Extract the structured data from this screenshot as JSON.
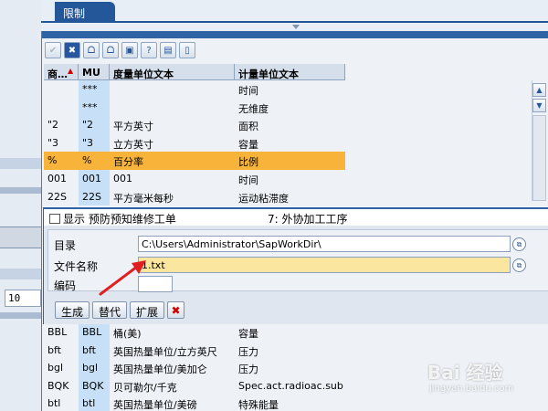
{
  "tab": {
    "label": "限制"
  },
  "table": {
    "headers": [
      "商…",
      "MU",
      "度量单位文本",
      "计量单位文本"
    ],
    "rows": [
      {
        "c1": "",
        "c2": "***",
        "c3": "",
        "c4": "时间"
      },
      {
        "c1": "",
        "c2": "***",
        "c3": "",
        "c4": "无维度"
      },
      {
        "c1": "\"2",
        "c2": "\"2",
        "c3": "平方英寸",
        "c4": "面积"
      },
      {
        "c1": "\"3",
        "c2": "\"3",
        "c3": "立方英寸",
        "c4": "容量"
      },
      {
        "c1": "%",
        "c2": "%",
        "c3": "百分率",
        "c4": "比例"
      },
      {
        "c1": "001",
        "c2": "001",
        "c3": "001",
        "c4": "时间"
      },
      {
        "c1": "22S",
        "c2": "22S",
        "c3": "平方毫米每秒",
        "c4": "运动粘滞度"
      }
    ],
    "lower_rows": [
      {
        "c1": "BBL",
        "c2": "BBL",
        "c3": "桶(美)",
        "c4": "容量"
      },
      {
        "c1": "bft",
        "c2": "bft",
        "c3": "英国热量单位/立方英尺",
        "c4": "压力"
      },
      {
        "c1": "bgl",
        "c2": "bgl",
        "c3": "英国热量单位/美加仑",
        "c4": "压力"
      },
      {
        "c1": "BQK",
        "c2": "BQK",
        "c3": "贝可勒尔/千克",
        "c4": "Spec.act.radioac.sub"
      },
      {
        "c1": "btl",
        "c2": "btl",
        "c3": "英国热量单位/美磅",
        "c4": "特殊能量"
      }
    ]
  },
  "dialog": {
    "title_left": "显示 预防预知维修工单",
    "title_right": "7: 外协加工工序",
    "dir_label": "目录",
    "dir_value": "C:\\Users\\Administrator\\SapWorkDir\\",
    "file_label": "文件名称",
    "file_value": "1.txt",
    "code_label": "编码",
    "code_value": "",
    "buttons": {
      "generate": "生成",
      "replace": "替代",
      "extend": "扩展",
      "cancel": "✖"
    }
  },
  "left": {
    "input_value": "10"
  },
  "watermark": {
    "text": "Bai 经验",
    "sub": "jingyan.baidu.com"
  },
  "colors": {
    "accent": "#24579a",
    "selected_row": "#f8b43a",
    "filename_bg": "#fbe6a0",
    "arrow": "#e02020"
  },
  "icons": [
    "check-icon",
    "close-icon",
    "binoculars-icon",
    "binoculars-plus-icon",
    "export-icon",
    "help-icon",
    "print-icon",
    "document-icon"
  ]
}
